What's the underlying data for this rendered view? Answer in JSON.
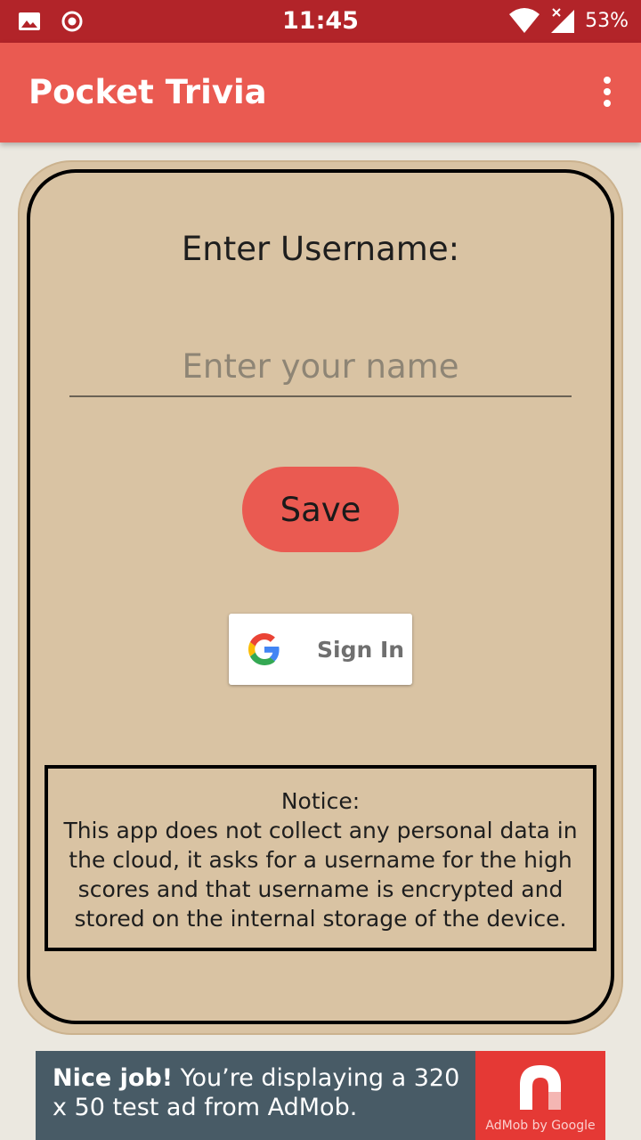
{
  "status_bar": {
    "time": "11:45",
    "battery": "53%",
    "icons": [
      "image-icon",
      "record-icon",
      "wifi-icon",
      "signal-icon",
      "battery-icon"
    ]
  },
  "app_bar": {
    "title": "Pocket Trivia",
    "menu_icon": "overflow-menu-icon"
  },
  "form": {
    "heading": "Enter Username:",
    "input_value": "",
    "input_placeholder": "Enter your name",
    "save_label": "Save",
    "signin_label": "Sign In"
  },
  "notice": {
    "title": "Notice:",
    "body": "This app does not collect any personal data in the cloud, it asks for a username for the high scores and that username is encrypted and stored on the internal storage of the device."
  },
  "ad": {
    "bold_text": "Nice job!",
    "text": " You’re displaying a 320 x 50 test ad from AdMob.",
    "brand": "AdMob by Google"
  },
  "colors": {
    "status_bar": "#b22429",
    "app_bar": "#ea5a51",
    "card": "#d9c3a3",
    "ad_background": "#485b66",
    "ad_logo_panel": "#e53935"
  }
}
